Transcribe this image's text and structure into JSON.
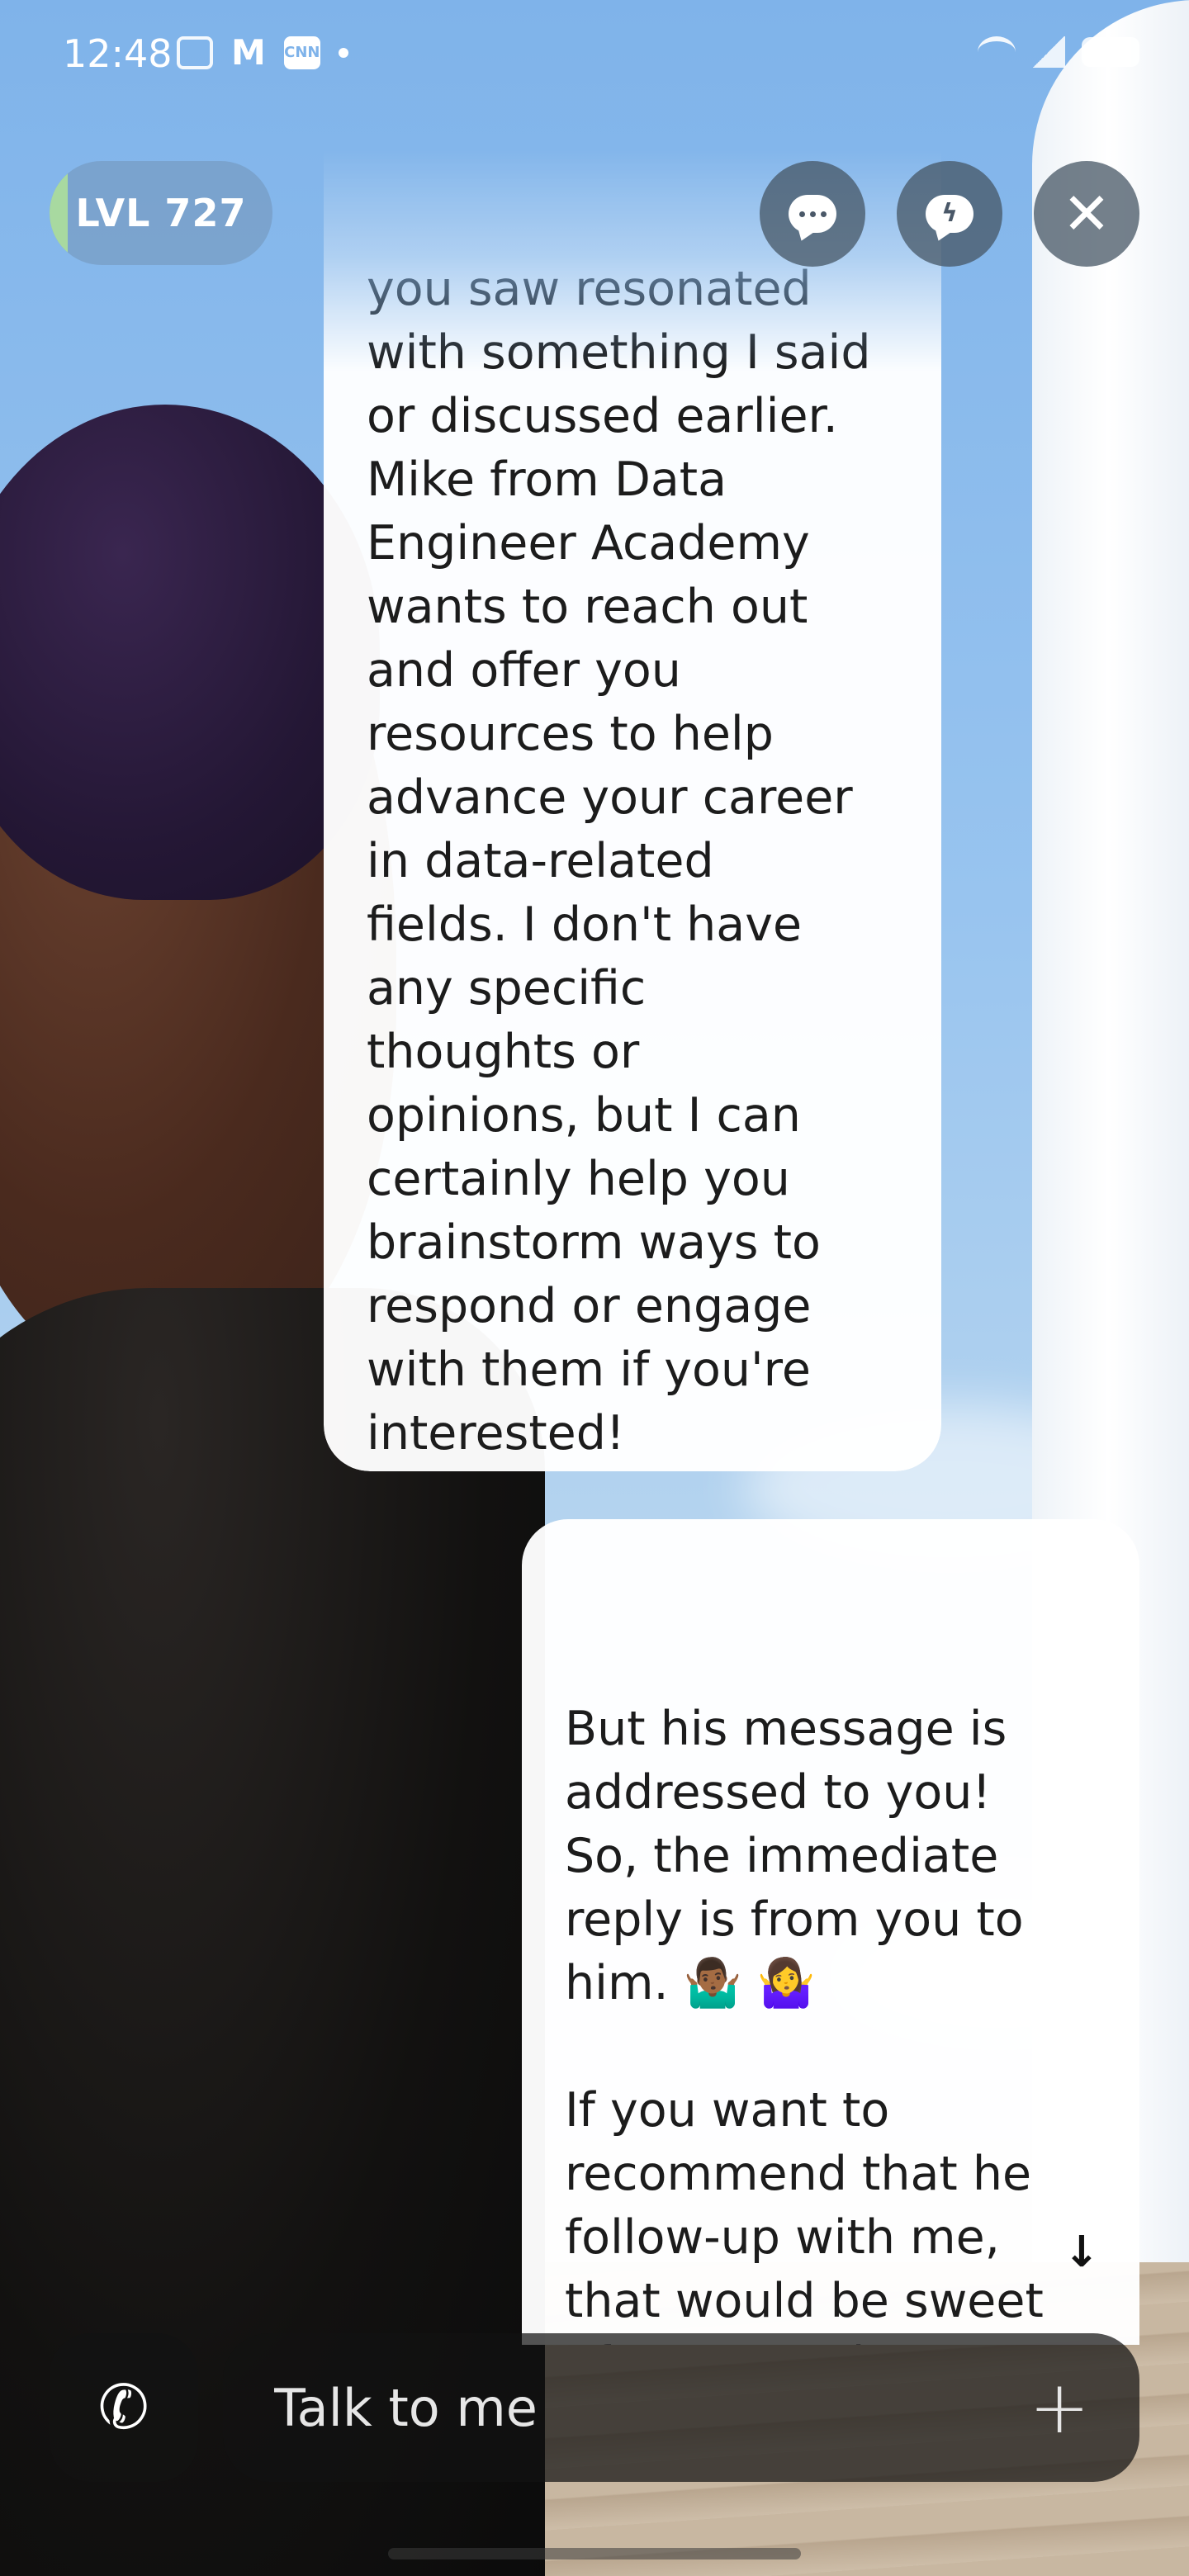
{
  "status_bar": {
    "time": "12:48",
    "left_icons": [
      "screenshot-icon",
      "gmail-icon",
      "cnn-icon",
      "dot-icon"
    ],
    "right_icons": [
      "wifi-icon",
      "signal-icon",
      "battery-icon"
    ],
    "mail_glyph": "M",
    "cnn_label": "CNN"
  },
  "header": {
    "level_label": "LVL 727",
    "buttons": [
      "chat-icon",
      "flash-chat-icon",
      "close-icon"
    ]
  },
  "conversation": {
    "bot_message": "you saw resonated\nwith something I said\nor discussed earlier.\nMike from Data\nEngineer Academy\nwants to reach out\nand offer you\nresources to help\nadvance your career\nin data-related\nfields. I don't have\nany specific\nthoughts or\nopinions, but I can\ncertainly help you\nbrainstorm ways to\nrespond or engage\nwith them if you're\ninterested!",
    "user_message": "But his message is\naddressed to you!\nSo, the immediate\nreply is from you to\nhim. 🤷🏾‍♂️ 🤷‍♀️\n\nIf you want to\nrecommend that he\nfollow-up with me,\nthat would be sweet\nof you. But, he\naddressed it to you."
  },
  "composer": {
    "placeholder": "Talk to me",
    "call_glyph": "✆",
    "plus_glyph": "+"
  },
  "colors": {
    "accent_level": "#a8d9a0",
    "bubble_bg": "#ffffff",
    "control_bg": "#46556a"
  }
}
